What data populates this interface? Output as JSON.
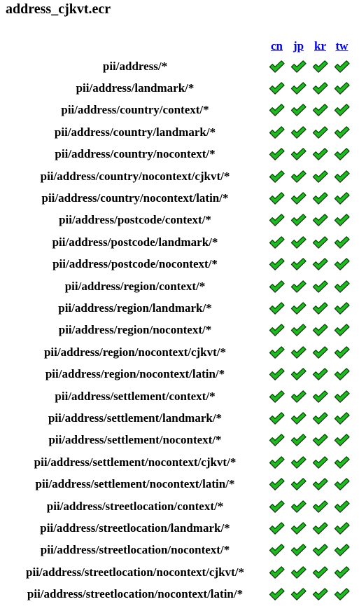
{
  "title": "address_cjkvt.ecr",
  "columns": [
    {
      "label": "cn"
    },
    {
      "label": "jp"
    },
    {
      "label": "kr"
    },
    {
      "label": "tw"
    }
  ],
  "status_icon": "checkmark-icon",
  "colors": {
    "link": "#0000ee",
    "check_fill": "#1fba1f",
    "check_outline": "#0b3d0b"
  },
  "rows": [
    {
      "label": "pii/address/*",
      "status": [
        "pass",
        "pass",
        "pass",
        "pass"
      ]
    },
    {
      "label": "pii/address/landmark/*",
      "status": [
        "pass",
        "pass",
        "pass",
        "pass"
      ]
    },
    {
      "label": "pii/address/country/context/*",
      "status": [
        "pass",
        "pass",
        "pass",
        "pass"
      ]
    },
    {
      "label": "pii/address/country/landmark/*",
      "status": [
        "pass",
        "pass",
        "pass",
        "pass"
      ]
    },
    {
      "label": "pii/address/country/nocontext/*",
      "status": [
        "pass",
        "pass",
        "pass",
        "pass"
      ]
    },
    {
      "label": "pii/address/country/nocontext/cjkvt/*",
      "status": [
        "pass",
        "pass",
        "pass",
        "pass"
      ]
    },
    {
      "label": "pii/address/country/nocontext/latin/*",
      "status": [
        "pass",
        "pass",
        "pass",
        "pass"
      ]
    },
    {
      "label": "pii/address/postcode/context/*",
      "status": [
        "pass",
        "pass",
        "pass",
        "pass"
      ]
    },
    {
      "label": "pii/address/postcode/landmark/*",
      "status": [
        "pass",
        "pass",
        "pass",
        "pass"
      ]
    },
    {
      "label": "pii/address/postcode/nocontext/*",
      "status": [
        "pass",
        "pass",
        "pass",
        "pass"
      ]
    },
    {
      "label": "pii/address/region/context/*",
      "status": [
        "pass",
        "pass",
        "pass",
        "pass"
      ]
    },
    {
      "label": "pii/address/region/landmark/*",
      "status": [
        "pass",
        "pass",
        "pass",
        "pass"
      ]
    },
    {
      "label": "pii/address/region/nocontext/*",
      "status": [
        "pass",
        "pass",
        "pass",
        "pass"
      ]
    },
    {
      "label": "pii/address/region/nocontext/cjkvt/*",
      "status": [
        "pass",
        "pass",
        "pass",
        "pass"
      ]
    },
    {
      "label": "pii/address/region/nocontext/latin/*",
      "status": [
        "pass",
        "pass",
        "pass",
        "pass"
      ]
    },
    {
      "label": "pii/address/settlement/context/*",
      "status": [
        "pass",
        "pass",
        "pass",
        "pass"
      ]
    },
    {
      "label": "pii/address/settlement/landmark/*",
      "status": [
        "pass",
        "pass",
        "pass",
        "pass"
      ]
    },
    {
      "label": "pii/address/settlement/nocontext/*",
      "status": [
        "pass",
        "pass",
        "pass",
        "pass"
      ]
    },
    {
      "label": "pii/address/settlement/nocontext/cjkvt/*",
      "status": [
        "pass",
        "pass",
        "pass",
        "pass"
      ]
    },
    {
      "label": "pii/address/settlement/nocontext/latin/*",
      "status": [
        "pass",
        "pass",
        "pass",
        "pass"
      ]
    },
    {
      "label": "pii/address/streetlocation/context/*",
      "status": [
        "pass",
        "pass",
        "pass",
        "pass"
      ]
    },
    {
      "label": "pii/address/streetlocation/landmark/*",
      "status": [
        "pass",
        "pass",
        "pass",
        "pass"
      ]
    },
    {
      "label": "pii/address/streetlocation/nocontext/*",
      "status": [
        "pass",
        "pass",
        "pass",
        "pass"
      ]
    },
    {
      "label": "pii/address/streetlocation/nocontext/cjkvt/*",
      "status": [
        "pass",
        "pass",
        "pass",
        "pass"
      ]
    },
    {
      "label": "pii/address/streetlocation/nocontext/latin/*",
      "status": [
        "pass",
        "pass",
        "pass",
        "pass"
      ]
    }
  ]
}
